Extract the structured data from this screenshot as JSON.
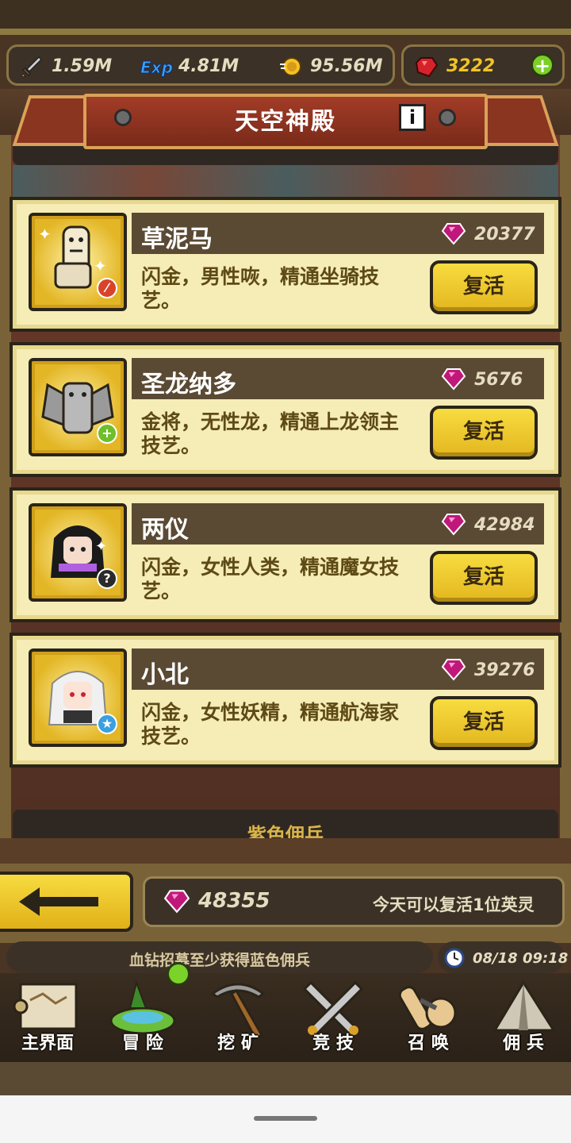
{
  "resources": {
    "attack": "1.59M",
    "exp_label": "Exp",
    "exp": "4.81M",
    "gold": "95.56M",
    "blood_gems": "3222"
  },
  "title": "天空神殿",
  "info_icon": "i",
  "heroes": [
    {
      "name": "草泥马",
      "cost": "20377",
      "desc": "闪金，男性咴，精通坐骑技艺。",
      "button": "复活",
      "badge_icon": "sword-badge-icon",
      "badge_color": "#d8442a"
    },
    {
      "name": "圣龙纳多",
      "cost": "5676",
      "desc": "金将，无性龙，精通上龙领主技艺。",
      "button": "复活",
      "badge_icon": "plus-badge-icon",
      "badge_color": "#6fbf2a"
    },
    {
      "name": "两仪",
      "cost": "42984",
      "desc": "闪金，女性人类，精通魔女技艺。",
      "button": "复活",
      "badge_icon": "question-badge-icon",
      "badge_color": "#2a2a2a"
    },
    {
      "name": "小北",
      "cost": "39276",
      "desc": "闪金，女性妖精，精通航海家技艺。",
      "button": "复活",
      "badge_icon": "star-badge-icon",
      "badge_color": "#3aa0e0"
    }
  ],
  "section_label": "紫色佣兵",
  "footer": {
    "gem_total": "48355",
    "revive_note": "今天可以复活1位英灵",
    "notice": "血钻招募至少获得蓝色佣兵",
    "datetime": "08/18 09:18"
  },
  "nav": [
    {
      "label": "主界面",
      "icon": "map-scroll-icon"
    },
    {
      "label": "冒 险",
      "icon": "island-icon"
    },
    {
      "label": "挖 矿",
      "icon": "pickaxe-icon"
    },
    {
      "label": "竞 技",
      "icon": "crossed-swords-icon"
    },
    {
      "label": "召 唤",
      "icon": "summon-scroll-icon"
    },
    {
      "label": "佣 兵",
      "icon": "tent-icon"
    }
  ],
  "badge_glyphs": {
    "plus": "+",
    "question": "?",
    "star": "★"
  },
  "colors": {
    "gem": "#c0187a",
    "gold": "#f2c323",
    "card": "#f6ecb6",
    "button": "#f7dc40"
  }
}
